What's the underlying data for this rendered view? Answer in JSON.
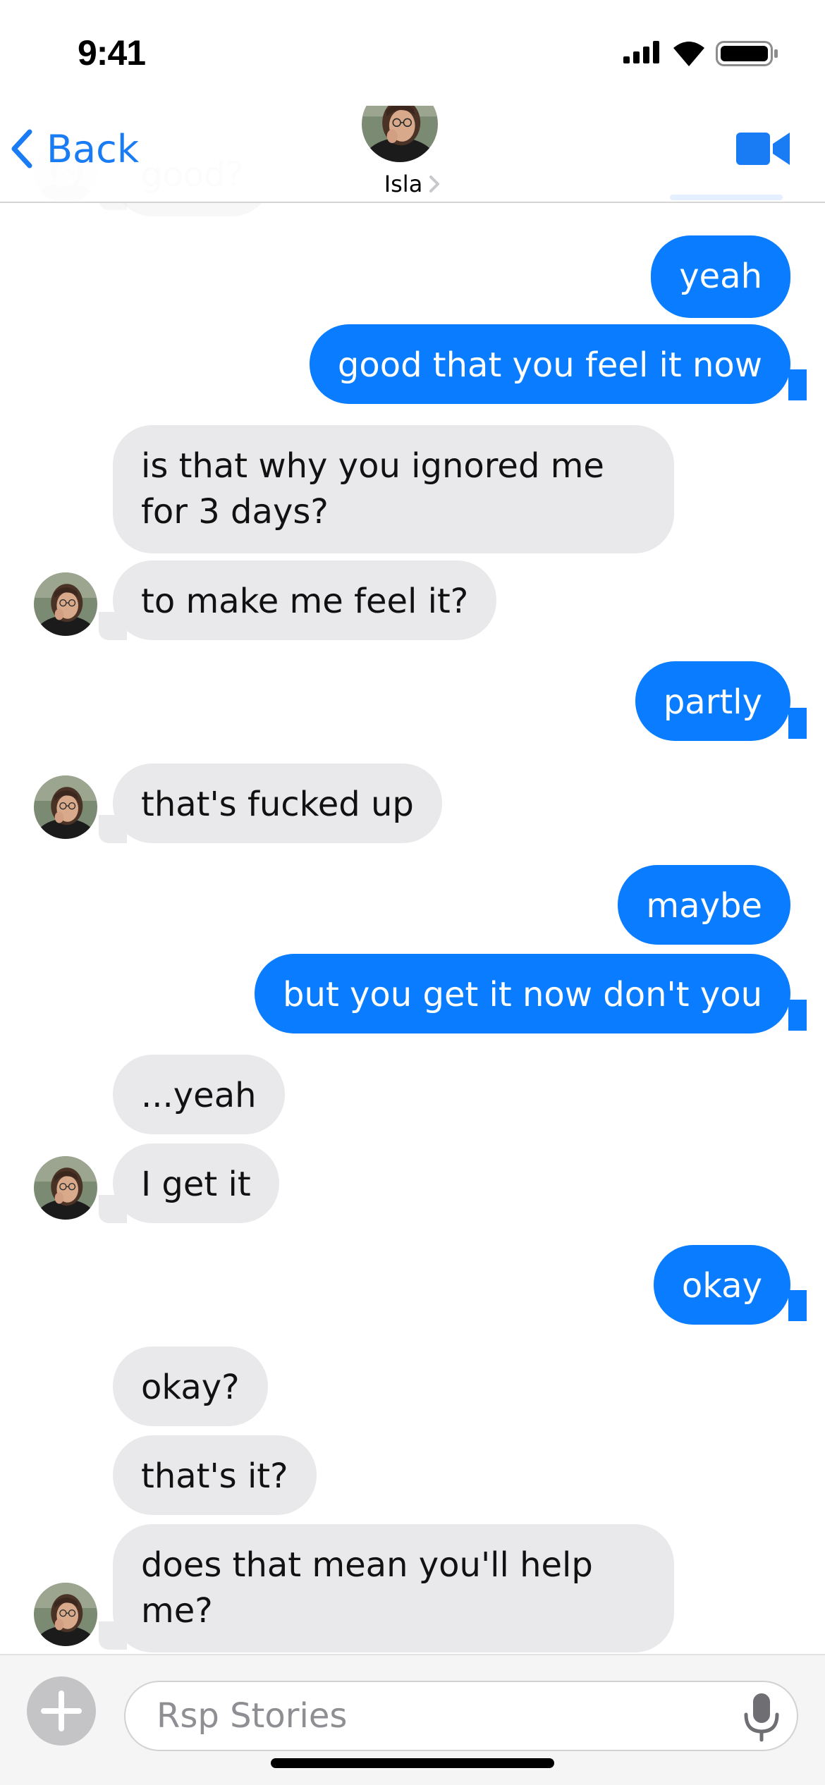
{
  "status_bar": {
    "time": "9:41",
    "icons": [
      "cellular-signal-icon",
      "wifi-icon",
      "battery-icon"
    ]
  },
  "header": {
    "back_label": "Back",
    "contact_name": "Isla",
    "icons": [
      "back-chevron-icon",
      "contact-avatar",
      "chevron-right-icon",
      "video-camera-icon"
    ]
  },
  "messages": [
    {
      "from": "contact",
      "text": "good?"
    },
    {
      "from": "me",
      "text": "yeah"
    },
    {
      "from": "me",
      "text": "good that you feel it now"
    },
    {
      "from": "contact",
      "text": "is that why you ignored me for 3 days?"
    },
    {
      "from": "contact",
      "text": "to make me feel it?"
    },
    {
      "from": "me",
      "text": "partly"
    },
    {
      "from": "contact",
      "text": "that's fucked up"
    },
    {
      "from": "me",
      "text": "maybe"
    },
    {
      "from": "me",
      "text": "but you get it now don't you"
    },
    {
      "from": "contact",
      "text": "...yeah"
    },
    {
      "from": "contact",
      "text": "I get it"
    },
    {
      "from": "me",
      "text": "okay"
    },
    {
      "from": "contact",
      "text": "okay?"
    },
    {
      "from": "contact",
      "text": "that's it?"
    },
    {
      "from": "contact",
      "text": "does that mean you'll help me?"
    }
  ],
  "compose": {
    "placeholder": "Rsp Stories",
    "icons": [
      "plus-icon",
      "microphone-icon"
    ]
  },
  "colors": {
    "accent": "#1a7cf5",
    "outgoing_bubble": "#0a7cff",
    "incoming_bubble": "#e9e9eb",
    "compose_background": "#f5f5f6"
  }
}
